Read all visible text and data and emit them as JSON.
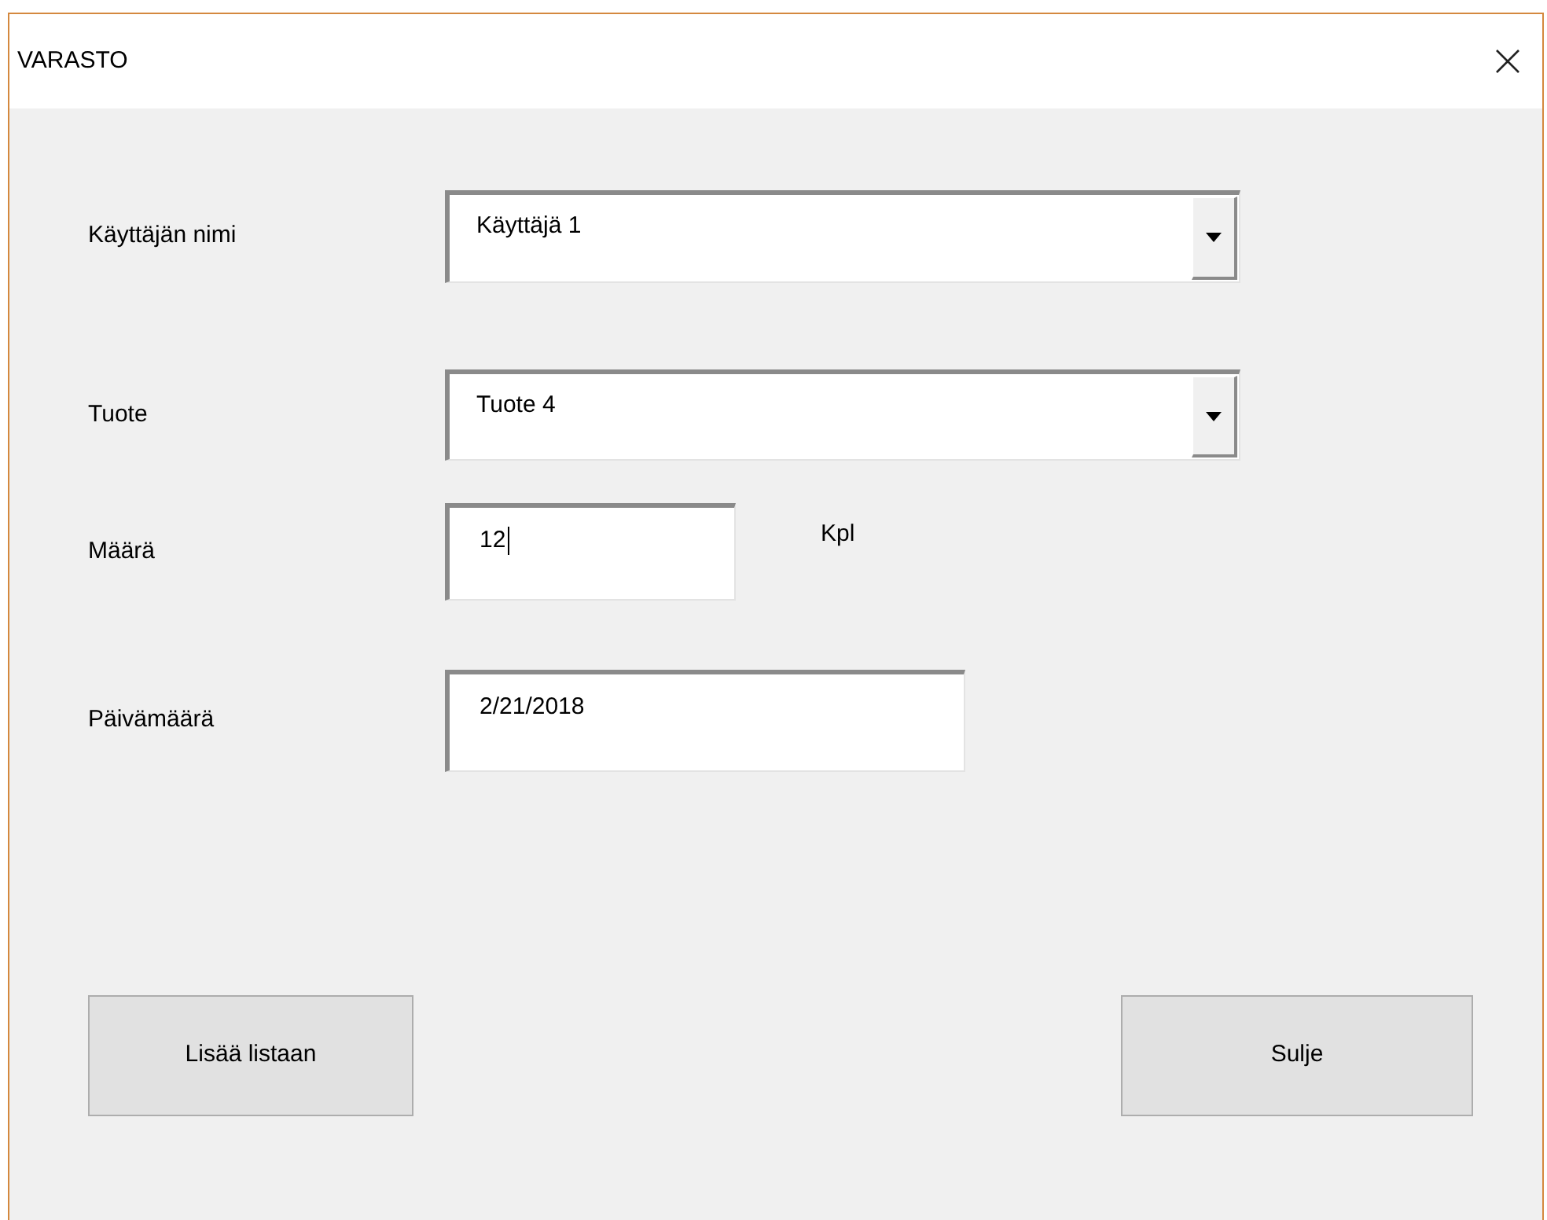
{
  "window": {
    "title": "VARASTO"
  },
  "fields": [
    {
      "kind": "combo",
      "label": "Käyttäjän nimi",
      "value": "Käyttäjä 1",
      "focused": false
    },
    {
      "kind": "combo",
      "label": "Tuote",
      "value": "Tuote 4",
      "focused": false
    },
    {
      "kind": "text",
      "label": "Määrä",
      "value": "12",
      "unit": "Kpl",
      "focused": true
    },
    {
      "kind": "text",
      "label": "Päivämäärä",
      "value": "2/21/2018",
      "focused": false
    }
  ],
  "buttons": [
    "Lisää listaan",
    "Sulje"
  ]
}
